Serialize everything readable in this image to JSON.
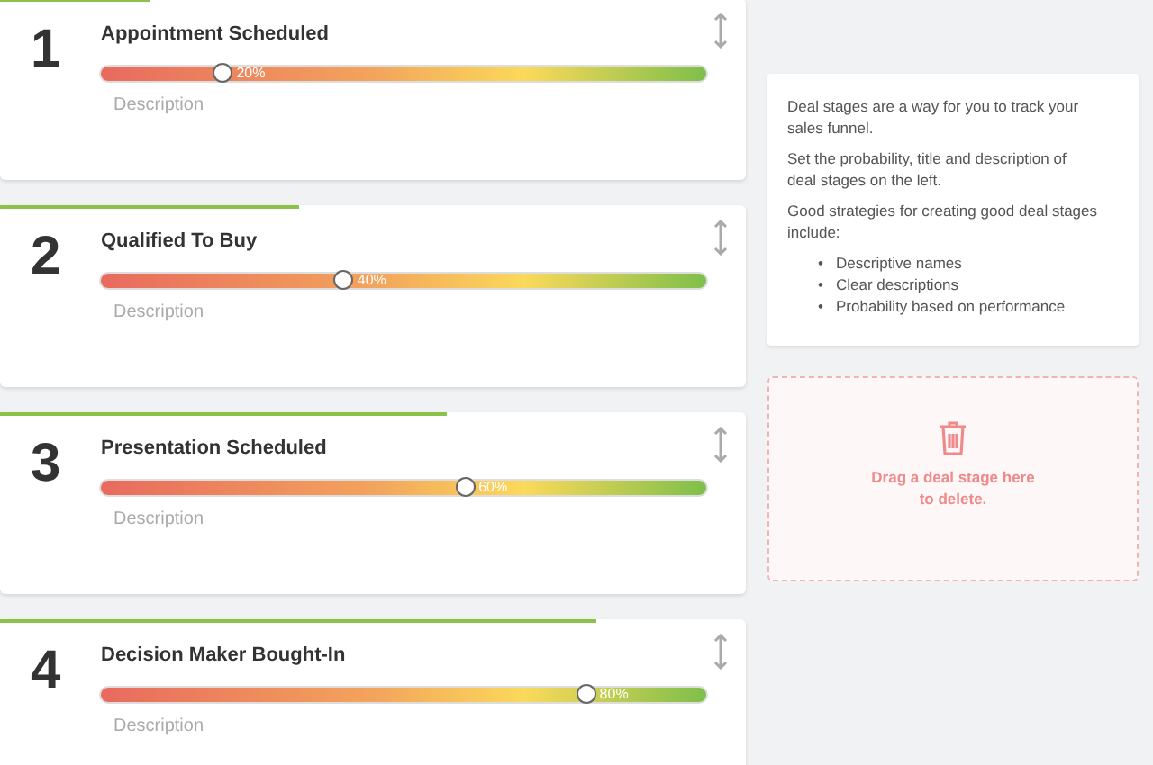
{
  "stages": [
    {
      "number": "1",
      "title": "Appointment Scheduled",
      "level": 0.2,
      "reading": "20%",
      "placeholder": "Description"
    },
    {
      "number": "2",
      "title": "Qualified To Buy",
      "level": 0.4,
      "reading": "40%",
      "placeholder": "Description"
    },
    {
      "number": "3",
      "title": "Presentation Scheduled",
      "level": 0.6,
      "reading": "60%",
      "placeholder": "Description"
    },
    {
      "number": "4",
      "title": "Decision Maker Bought-In",
      "level": 0.8,
      "reading": "80%",
      "placeholder": "Description"
    }
  ],
  "info": {
    "paragraphs": [
      "Deal stages are a way for you to track your sales funnel.",
      "Set the probability, title and description of deal stages on the left.",
      "Good strategies for creating good deal stages include:"
    ],
    "bullets": [
      {
        "marker": "•",
        "text": "Descriptive names"
      },
      {
        "marker": "•",
        "text": "Clear descriptions"
      },
      {
        "marker": "•",
        "text": "Probability based on performance"
      }
    ]
  },
  "dropzone": {
    "text": "Drag a deal stage here to delete."
  }
}
